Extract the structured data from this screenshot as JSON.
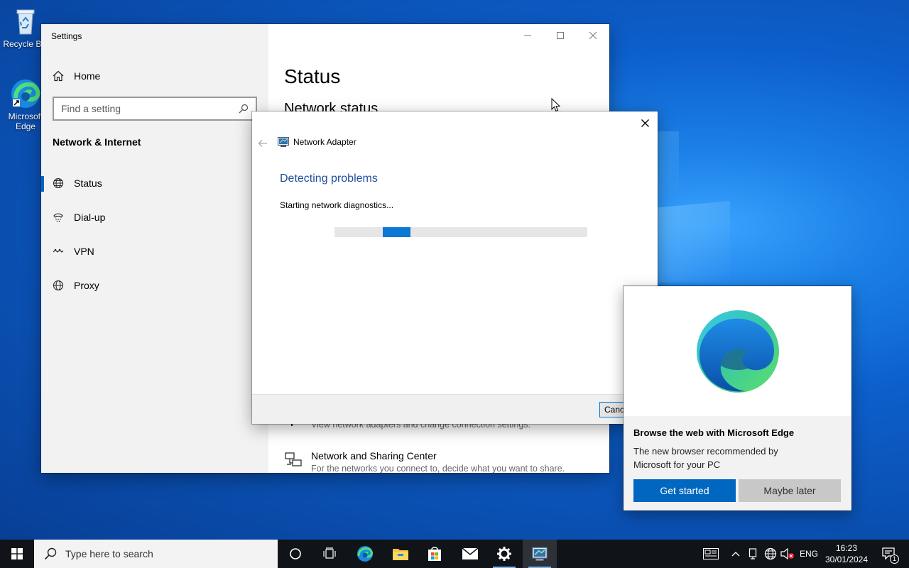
{
  "desktop": {
    "icons": [
      {
        "label": "Recycle Bin"
      },
      {
        "label": "Microsoft Edge"
      }
    ]
  },
  "settings": {
    "title": "Settings",
    "nav": {
      "home": "Home",
      "search_placeholder": "Find a setting",
      "section": "Network & Internet",
      "items": [
        {
          "label": "Status",
          "icon": "globe-status-icon",
          "active": true
        },
        {
          "label": "Dial-up",
          "icon": "dial-up-icon",
          "active": false
        },
        {
          "label": "VPN",
          "icon": "vpn-icon",
          "active": false
        },
        {
          "label": "Proxy",
          "icon": "globe-icon",
          "active": false
        }
      ]
    },
    "content": {
      "heading": "Status",
      "subheading": "Network status",
      "items": [
        {
          "title": "",
          "desc": "View network adapters and change connection settings."
        },
        {
          "title": "Network and Sharing Center",
          "desc": "For the networks you connect to, decide what you want to share."
        }
      ]
    }
  },
  "dialog": {
    "app_name": "Network Adapter",
    "heading": "Detecting problems",
    "status": "Starting network diagnostics...",
    "progress_indeterminate": true,
    "cancel_label": "Cancel"
  },
  "promo": {
    "title": "Browse the web with Microsoft Edge",
    "desc": "The new browser recommended by Microsoft for your PC",
    "primary": "Get started",
    "secondary": "Maybe later"
  },
  "taskbar": {
    "search_placeholder": "Type here to search",
    "pinned": [
      "task-view-cortana-icon",
      "task-view-icon",
      "edge-icon",
      "file-explorer-icon",
      "store-icon",
      "mail-icon",
      "settings-icon",
      "troubleshooter-icon"
    ],
    "tray": {
      "language": "ENG",
      "time": "16:23",
      "date": "30/01/2024",
      "notification_count": "1"
    }
  },
  "colors": {
    "accent": "#0067c0",
    "heading_blue": "#1e4f9c",
    "taskbar": "#101418"
  }
}
